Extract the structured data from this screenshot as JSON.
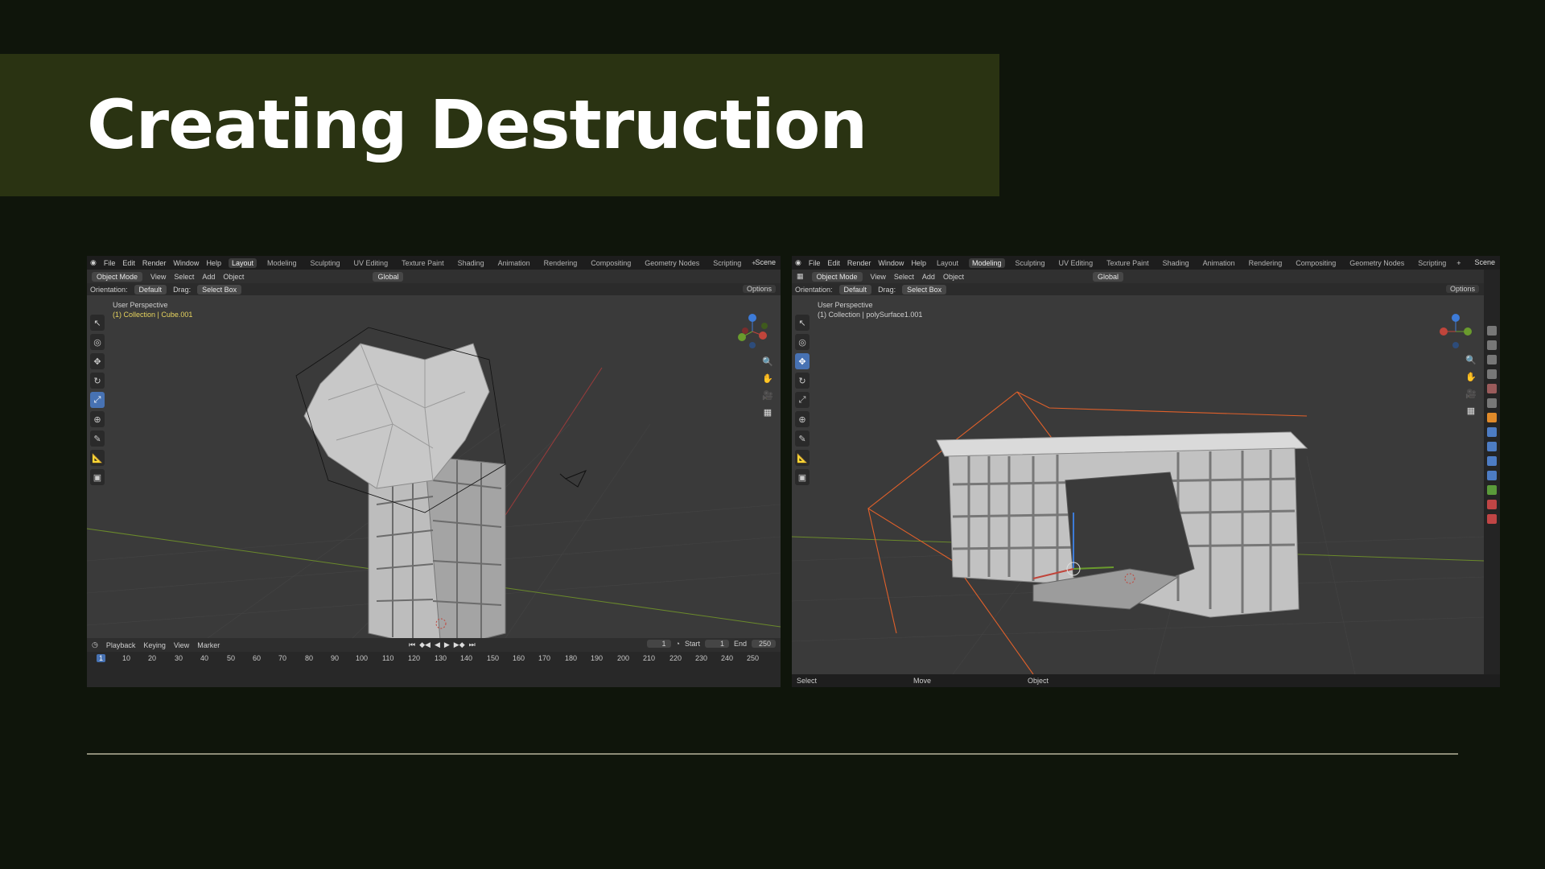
{
  "slide": {
    "title": "Creating Destruction"
  },
  "left_window": {
    "menu": [
      "File",
      "Edit",
      "Render",
      "Window",
      "Help"
    ],
    "workspaces": [
      "Layout",
      "Modeling",
      "Sculpting",
      "UV Editing",
      "Texture Paint",
      "Shading",
      "Animation",
      "Rendering",
      "Compositing",
      "Geometry Nodes",
      "Scripting"
    ],
    "active_workspace": "Layout",
    "scene": "Scene",
    "header": {
      "mode": "Object Mode",
      "menus": [
        "View",
        "Select",
        "Add",
        "Object"
      ],
      "transform": "Global"
    },
    "tool_settings": {
      "orientation_label": "Orientation:",
      "orientation": "Default",
      "drag_label": "Drag:",
      "drag": "Select Box",
      "options": "Options"
    },
    "viewport": {
      "view_name": "User Perspective",
      "selection": "(1) Collection | Cube.001"
    },
    "timeline": {
      "menus": [
        "Playback",
        "Keying",
        "View",
        "Marker"
      ],
      "current_frame": "1",
      "start_label": "Start",
      "start": "1",
      "end_label": "End",
      "end": "250",
      "ruler": [
        "1",
        "10",
        "20",
        "30",
        "40",
        "50",
        "60",
        "70",
        "80",
        "90",
        "100",
        "110",
        "120",
        "130",
        "140",
        "150",
        "160",
        "170",
        "180",
        "190",
        "200",
        "210",
        "220",
        "230",
        "240",
        "250"
      ]
    }
  },
  "right_window": {
    "menu": [
      "File",
      "Edit",
      "Render",
      "Window",
      "Help"
    ],
    "workspaces": [
      "Layout",
      "Modeling",
      "Sculpting",
      "UV Editing",
      "Texture Paint",
      "Shading",
      "Animation",
      "Rendering",
      "Compositing",
      "Geometry Nodes",
      "Scripting"
    ],
    "active_workspace": "Modeling",
    "scene": "Scene",
    "header": {
      "mode": "Object Mode",
      "menus": [
        "View",
        "Select",
        "Add",
        "Object"
      ],
      "transform": "Global"
    },
    "tool_settings": {
      "orientation_label": "Orientation:",
      "orientation": "Default",
      "drag_label": "Drag:",
      "drag": "Select Box",
      "options": "Options"
    },
    "viewport": {
      "view_name": "User Perspective",
      "selection": "(1) Collection | polySurface1.001"
    },
    "status": [
      "Select",
      "Move",
      "Object"
    ]
  },
  "colors": {
    "background": "#0f150b",
    "title_band": "#2a3312",
    "accent_blue": "#4772b3",
    "selection_orange": "#e0602a"
  }
}
